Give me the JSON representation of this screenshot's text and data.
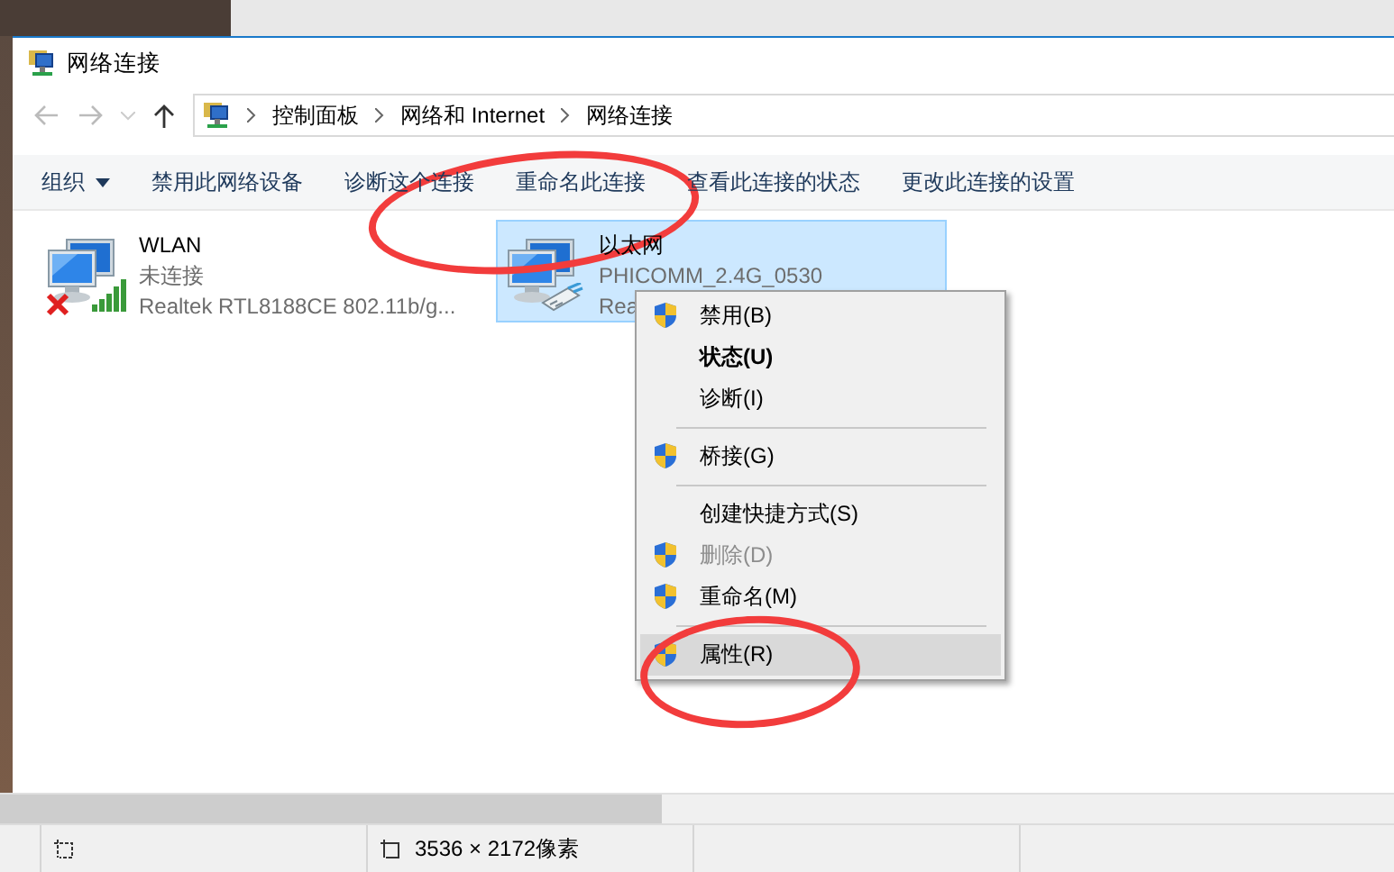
{
  "window": {
    "title": "网络连接"
  },
  "address_bar": {
    "path": [
      "控制面板",
      "网络和 Internet",
      "网络连接"
    ]
  },
  "toolbar": [
    {
      "label": "组织",
      "kind": "dropdown",
      "circled": false
    },
    {
      "label": "禁用此网络设备",
      "kind": "command",
      "circled": false
    },
    {
      "label": "诊断这个连接",
      "kind": "command",
      "circled": false
    },
    {
      "label": "重命名此连接",
      "kind": "command",
      "circled": true
    },
    {
      "label": "查看此连接的状态",
      "kind": "command",
      "circled": false
    },
    {
      "label": "更改此连接的设置",
      "kind": "command",
      "circled": false
    }
  ],
  "connections": [
    {
      "name": "WLAN",
      "status": "未连接",
      "adapter": "Realtek RTL8188CE 802.11b/g...",
      "kind": "wireless",
      "disconnected": true,
      "selected": false
    },
    {
      "name": "以太网",
      "status": "PHICOMM_2.4G_0530",
      "adapter": "Rea",
      "kind": "ethernet",
      "disconnected": false,
      "selected": true
    }
  ],
  "context_menu": [
    {
      "kind": "shielded",
      "label": "禁用(B)",
      "disabled": false,
      "selected": false,
      "circled": false
    },
    {
      "kind": "default",
      "label": "状态(U)",
      "disabled": false,
      "selected": false,
      "circled": false
    },
    {
      "kind": "plain",
      "label": "诊断(I)",
      "disabled": false,
      "selected": false,
      "circled": false
    },
    {
      "kind": "separator"
    },
    {
      "kind": "shielded",
      "label": "桥接(G)",
      "disabled": false,
      "selected": false,
      "circled": false
    },
    {
      "kind": "separator"
    },
    {
      "kind": "plain",
      "label": "创建快捷方式(S)",
      "disabled": false,
      "selected": false,
      "circled": false
    },
    {
      "kind": "shielded",
      "label": "删除(D)",
      "disabled": true,
      "selected": false,
      "circled": false
    },
    {
      "kind": "shielded",
      "label": "重命名(M)",
      "disabled": false,
      "selected": false,
      "circled": false
    },
    {
      "kind": "separator"
    },
    {
      "kind": "shielded",
      "label": "属性(R)",
      "disabled": false,
      "selected": true,
      "circled": true
    }
  ],
  "status_bar": {
    "dimensions": "3536 × 2172像素"
  }
}
